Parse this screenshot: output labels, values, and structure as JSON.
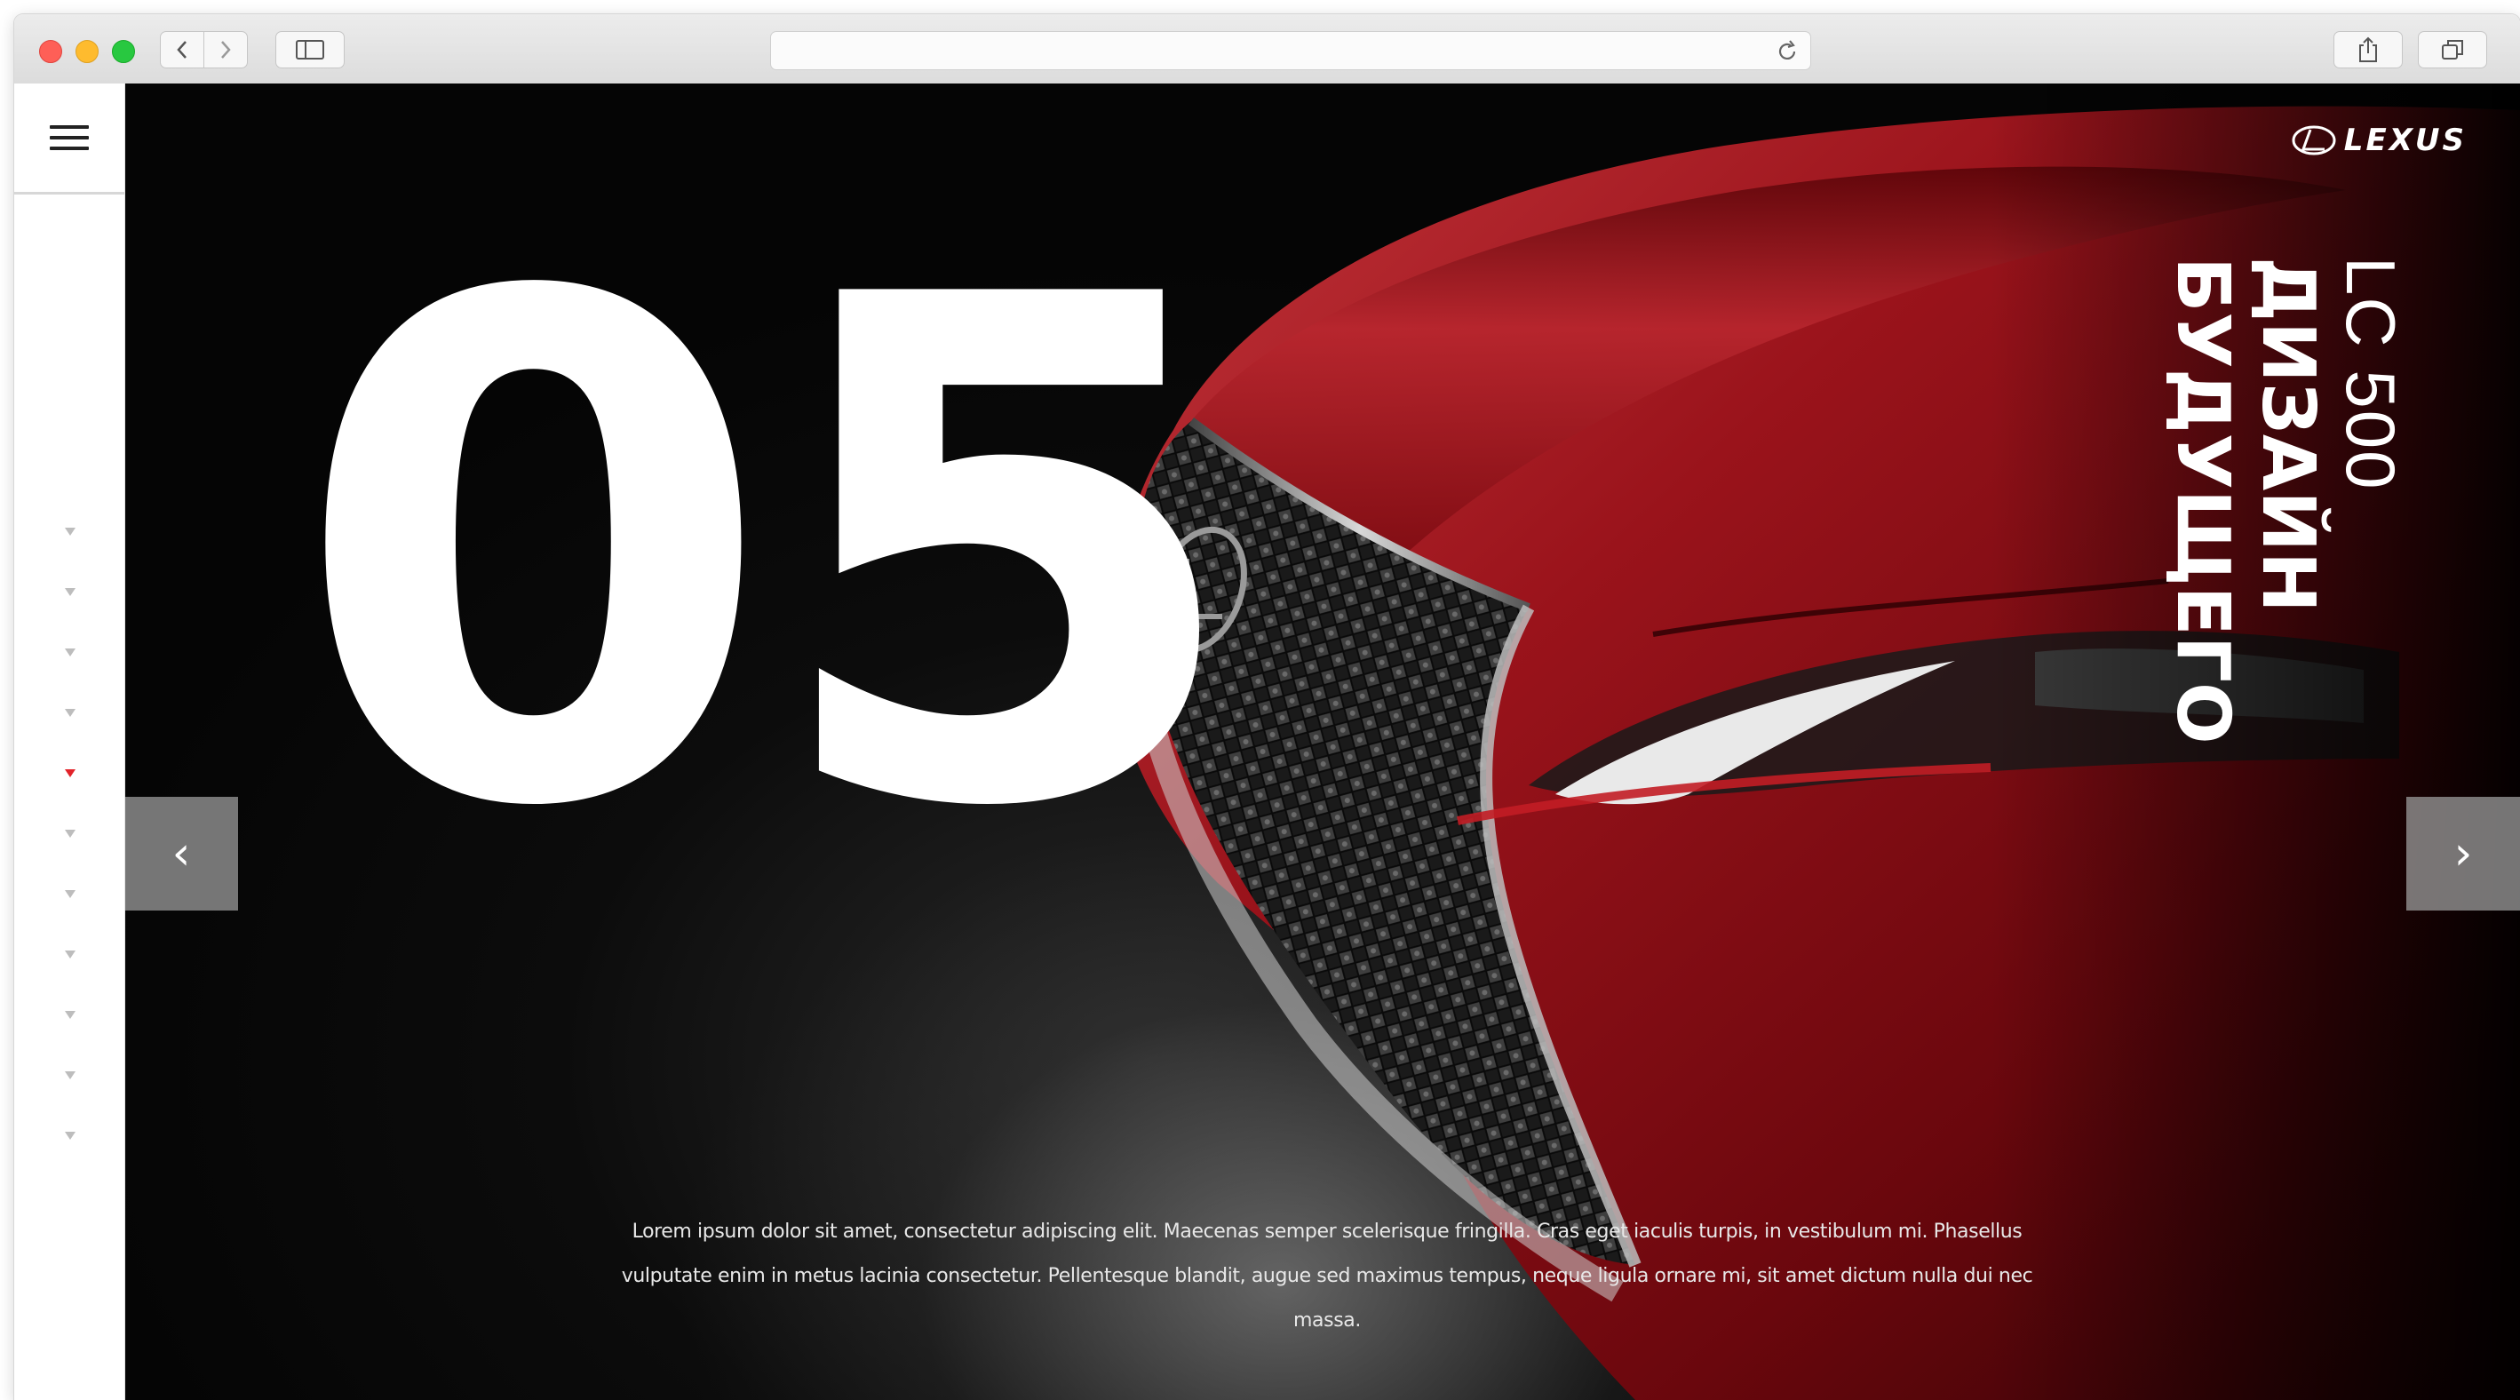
{
  "browser": {
    "address_text": "",
    "buttons": {
      "back": "back-chevron-icon",
      "forward": "forward-chevron-icon",
      "sidebar": "sidebar-icon",
      "reload": "reload-icon",
      "share": "share-icon",
      "tabs": "tabs-icon"
    }
  },
  "sidebar": {
    "menu_icon": "hamburger-icon",
    "dots": [
      {
        "active": false
      },
      {
        "active": false
      },
      {
        "active": false
      },
      {
        "active": false
      },
      {
        "active": true
      },
      {
        "active": false
      },
      {
        "active": false
      },
      {
        "active": false
      },
      {
        "active": false
      },
      {
        "active": false
      },
      {
        "active": false
      }
    ],
    "active_color": "#e2232a",
    "inactive_color": "#bdbdbd"
  },
  "hero": {
    "slide_number": "05",
    "model": "LC 500",
    "title_line1": "ДИЗАЙН",
    "title_line2": "БУДУЩЕГО",
    "brand": "LEXUS",
    "prev_arrow": "‹",
    "next_arrow": "›",
    "caption": "Lorem ipsum dolor sit amet, consectetur adipiscing elit. Maecenas semper scelerisque fringilla. Cras eget iaculis turpis, in vestibulum mi. Phasellus vulputate enim in metus lacinia consectetur. Pellentesque blandit, augue sed maximus tempus, neque ligula ornare mi, sit amet dictum nulla dui nec massa.",
    "car_color": "#8a0f16"
  }
}
